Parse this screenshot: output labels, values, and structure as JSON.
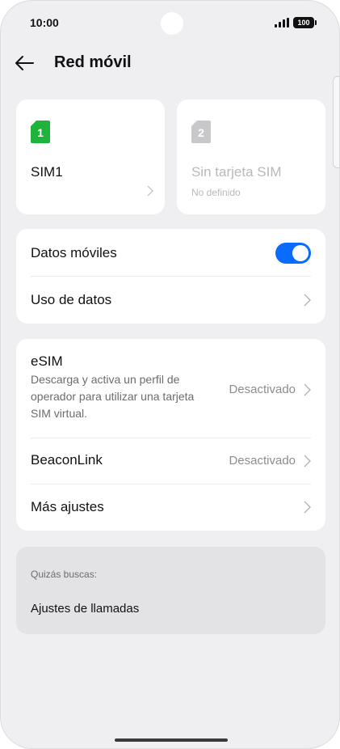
{
  "status_bar": {
    "time": "10:00",
    "battery": "100"
  },
  "header": {
    "title": "Red móvil"
  },
  "sims": [
    {
      "badge": "1",
      "name": "SIM1",
      "subtitle": "",
      "badge_color": "#1db33c"
    },
    {
      "badge": "2",
      "name": "Sin tarjeta SIM",
      "subtitle": "No definido",
      "badge_color": "#c8c8cb"
    }
  ],
  "mobile_data": {
    "label": "Datos móviles",
    "enabled": true,
    "toggle_color": "#0a6cff"
  },
  "data_usage": {
    "label": "Uso de datos"
  },
  "esim": {
    "label": "eSIM",
    "description": "Descarga y activa un perfil de operador para utilizar una tarjeta SIM virtual.",
    "value": "Desactivado"
  },
  "beaconlink": {
    "label": "BeaconLink",
    "value": "Desactivado"
  },
  "more_settings": {
    "label": "Más ajustes"
  },
  "suggestions": {
    "title": "Quizás buscas:",
    "items": [
      "Ajustes de llamadas"
    ]
  }
}
